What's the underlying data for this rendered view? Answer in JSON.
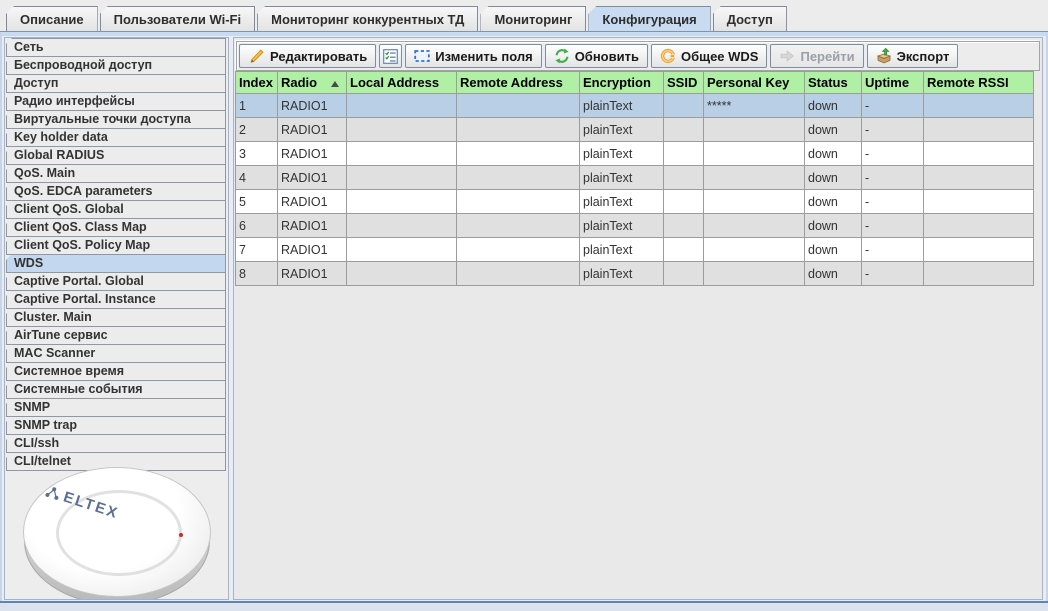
{
  "tabs": [
    {
      "label": "Описание",
      "active": false
    },
    {
      "label": "Пользователи Wi-Fi",
      "active": false
    },
    {
      "label": "Мониторинг конкурентных ТД",
      "active": false
    },
    {
      "label": "Мониторинг",
      "active": false
    },
    {
      "label": "Конфигурация",
      "active": true
    },
    {
      "label": "Доступ",
      "active": false
    }
  ],
  "sidebar": {
    "items": [
      {
        "label": "Сеть",
        "selected": false
      },
      {
        "label": "Беспроводной доступ",
        "selected": false
      },
      {
        "label": "Доступ",
        "selected": false
      },
      {
        "label": "Радио интерфейсы",
        "selected": false
      },
      {
        "label": "Виртуальные точки доступа",
        "selected": false
      },
      {
        "label": "Key holder data",
        "selected": false
      },
      {
        "label": "Global RADIUS",
        "selected": false
      },
      {
        "label": "QoS. Main",
        "selected": false
      },
      {
        "label": "QoS. EDCA parameters",
        "selected": false
      },
      {
        "label": "Client QoS. Global",
        "selected": false
      },
      {
        "label": "Client QoS. Class Map",
        "selected": false
      },
      {
        "label": "Client QoS. Policy Map",
        "selected": false
      },
      {
        "label": "WDS",
        "selected": true
      },
      {
        "label": "Captive Portal. Global",
        "selected": false
      },
      {
        "label": "Captive Portal. Instance",
        "selected": false
      },
      {
        "label": "Cluster. Main",
        "selected": false
      },
      {
        "label": "AirTune сервис",
        "selected": false
      },
      {
        "label": "MAC Scanner",
        "selected": false
      },
      {
        "label": "Системное время",
        "selected": false
      },
      {
        "label": "Системные события",
        "selected": false
      },
      {
        "label": "SNMP",
        "selected": false
      },
      {
        "label": "SNMP trap",
        "selected": false
      },
      {
        "label": "CLI/ssh",
        "selected": false
      },
      {
        "label": "CLI/telnet",
        "selected": false
      }
    ]
  },
  "toolbar": {
    "buttons": [
      {
        "label": "Редактировать",
        "icon": "pencil-icon",
        "disabled": false
      },
      {
        "label": "",
        "icon": "column-list-icon",
        "disabled": false
      },
      {
        "label": "Изменить поля",
        "icon": "select-fields-icon",
        "disabled": false
      },
      {
        "label": "Обновить",
        "icon": "refresh-icon",
        "disabled": false
      },
      {
        "label": "Общее WDS",
        "icon": "wds-ring-icon",
        "disabled": false
      },
      {
        "label": "Перейти",
        "icon": "go-arrow-icon",
        "disabled": true
      },
      {
        "label": "Экспорт",
        "icon": "export-icon",
        "disabled": false
      }
    ]
  },
  "table": {
    "columns": [
      {
        "key": "index",
        "label": "Index",
        "sorted": ""
      },
      {
        "key": "radio",
        "label": "Radio",
        "sorted": "asc"
      },
      {
        "key": "local_address",
        "label": "Local Address",
        "sorted": ""
      },
      {
        "key": "remote_address",
        "label": "Remote Address",
        "sorted": ""
      },
      {
        "key": "encryption",
        "label": "Encryption",
        "sorted": ""
      },
      {
        "key": "ssid",
        "label": "SSID",
        "sorted": ""
      },
      {
        "key": "personal_key",
        "label": "Personal Key",
        "sorted": ""
      },
      {
        "key": "status",
        "label": "Status",
        "sorted": ""
      },
      {
        "key": "uptime",
        "label": "Uptime",
        "sorted": ""
      },
      {
        "key": "remote_rssi",
        "label": "Remote RSSI",
        "sorted": ""
      }
    ],
    "rows": [
      {
        "index": "1",
        "radio": "RADIO1",
        "local_address": "",
        "remote_address": "",
        "encryption": "plainText",
        "ssid": "",
        "personal_key": "*****",
        "status": "down",
        "uptime": "-",
        "remote_rssi": "",
        "selected": true
      },
      {
        "index": "2",
        "radio": "RADIO1",
        "local_address": "",
        "remote_address": "",
        "encryption": "plainText",
        "ssid": "",
        "personal_key": "",
        "status": "down",
        "uptime": "-",
        "remote_rssi": "",
        "selected": false
      },
      {
        "index": "3",
        "radio": "RADIO1",
        "local_address": "",
        "remote_address": "",
        "encryption": "plainText",
        "ssid": "",
        "personal_key": "",
        "status": "down",
        "uptime": "-",
        "remote_rssi": "",
        "selected": false
      },
      {
        "index": "4",
        "radio": "RADIO1",
        "local_address": "",
        "remote_address": "",
        "encryption": "plainText",
        "ssid": "",
        "personal_key": "",
        "status": "down",
        "uptime": "-",
        "remote_rssi": "",
        "selected": false
      },
      {
        "index": "5",
        "radio": "RADIO1",
        "local_address": "",
        "remote_address": "",
        "encryption": "plainText",
        "ssid": "",
        "personal_key": "",
        "status": "down",
        "uptime": "-",
        "remote_rssi": "",
        "selected": false
      },
      {
        "index": "6",
        "radio": "RADIO1",
        "local_address": "",
        "remote_address": "",
        "encryption": "plainText",
        "ssid": "",
        "personal_key": "",
        "status": "down",
        "uptime": "-",
        "remote_rssi": "",
        "selected": false
      },
      {
        "index": "7",
        "radio": "RADIO1",
        "local_address": "",
        "remote_address": "",
        "encryption": "plainText",
        "ssid": "",
        "personal_key": "",
        "status": "down",
        "uptime": "-",
        "remote_rssi": "",
        "selected": false
      },
      {
        "index": "8",
        "radio": "RADIO1",
        "local_address": "",
        "remote_address": "",
        "encryption": "plainText",
        "ssid": "",
        "personal_key": "",
        "status": "down",
        "uptime": "-",
        "remote_rssi": "",
        "selected": false
      }
    ]
  },
  "device": {
    "label": "ELTEX"
  }
}
